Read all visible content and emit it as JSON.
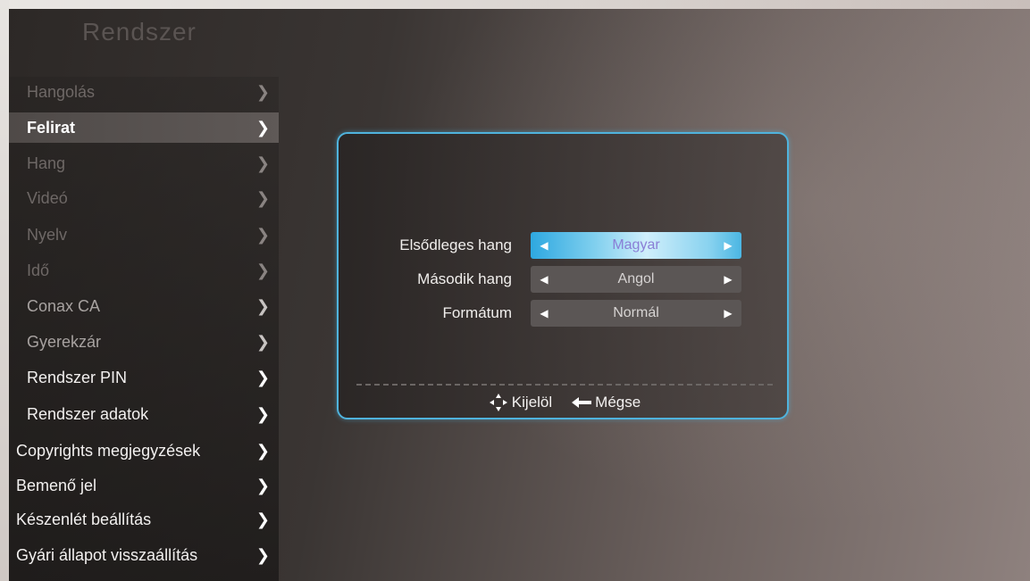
{
  "menu": {
    "title": "Rendszer",
    "items": [
      {
        "label": "Hangolás"
      },
      {
        "label": "Felirat"
      },
      {
        "label": "Hang"
      },
      {
        "label": "Videó"
      },
      {
        "label": "Nyelv"
      },
      {
        "label": "Idő"
      },
      {
        "label": "Conax CA"
      },
      {
        "label": "Gyerekzár"
      },
      {
        "label": "Rendszer PIN"
      },
      {
        "label": "Rendszer adatok"
      },
      {
        "label": "Copyrights megjegyzések"
      },
      {
        "label": "Bemenő jel"
      },
      {
        "label": "Készenlét beállítás"
      },
      {
        "label": "Gyári állapot visszaállítás"
      }
    ],
    "selected_label": "Felirat"
  },
  "dialog": {
    "rows": [
      {
        "label": "Elsődleges hang",
        "value": "Magyar"
      },
      {
        "label": "Második hang",
        "value": "Angol"
      },
      {
        "label": "Formátum",
        "value": "Normál"
      }
    ],
    "footer": {
      "select_label": "Kijelöl",
      "cancel_label": "Mégse"
    }
  },
  "colors": {
    "accent": "#4fb3dd",
    "selected_value_text": "#8a7fd6"
  },
  "icons": {
    "chevron": "chevron-right-icon",
    "nav": "four-way-arrow-icon",
    "back": "back-arrow-icon"
  }
}
